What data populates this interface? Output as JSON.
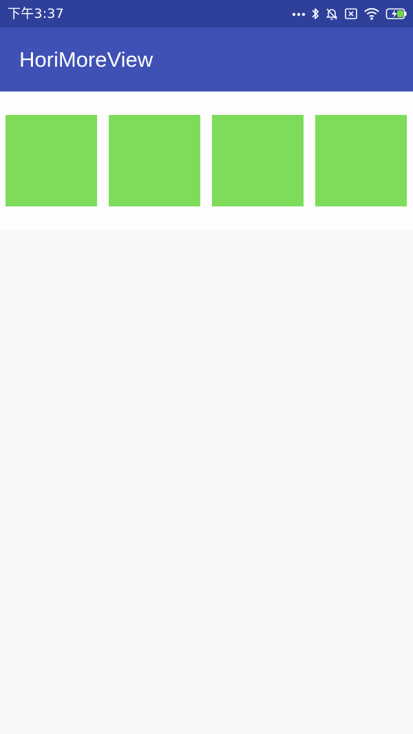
{
  "status_bar": {
    "time": "下午3:37",
    "icons": [
      "more-dots-icon",
      "bluetooth-icon",
      "muted-bell-icon",
      "sim-card-icon",
      "wifi-icon",
      "battery-charging-icon"
    ]
  },
  "app_bar": {
    "title": "HoriMoreView"
  },
  "list": {
    "items": [
      {
        "color": "#7ddd5b"
      },
      {
        "color": "#7ddd5b"
      },
      {
        "color": "#7ddd5b"
      },
      {
        "color": "#7ddd5b"
      }
    ]
  }
}
